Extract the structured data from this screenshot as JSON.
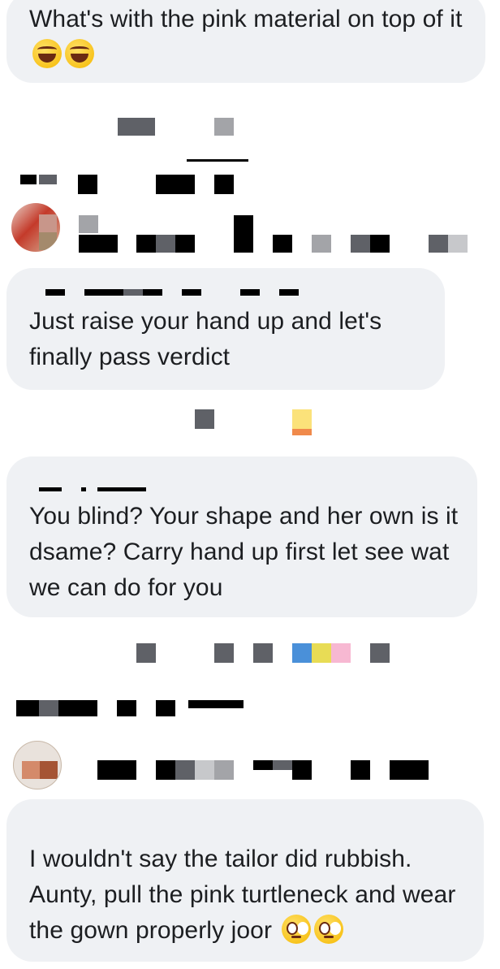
{
  "comments": [
    {
      "id": "c1",
      "text": "What's with the pink material on top of it",
      "emojis": [
        "rolling-on-floor-laughing",
        "rolling-on-floor-laughing"
      ]
    },
    {
      "id": "c2",
      "text": "Just raise your hand up and let's finally pass verdict",
      "emojis": []
    },
    {
      "id": "c3",
      "text": "You blind? Your shape and her own is it dsame? Carry hand up first let see wat we can do for you",
      "emojis": []
    },
    {
      "id": "c4",
      "text": "I wouldn't say the tailor did rubbish. Aunty, pull the pink turtleneck and wear the gown properly joor",
      "emojis": [
        "face-with-rolling-eyes",
        "face-with-rolling-eyes"
      ]
    }
  ],
  "colors": {
    "bubble_bg": "#eff1f4",
    "text": "#1c1e21",
    "redaction_dark": "#000000",
    "redaction_gray": "#5f6167"
  }
}
